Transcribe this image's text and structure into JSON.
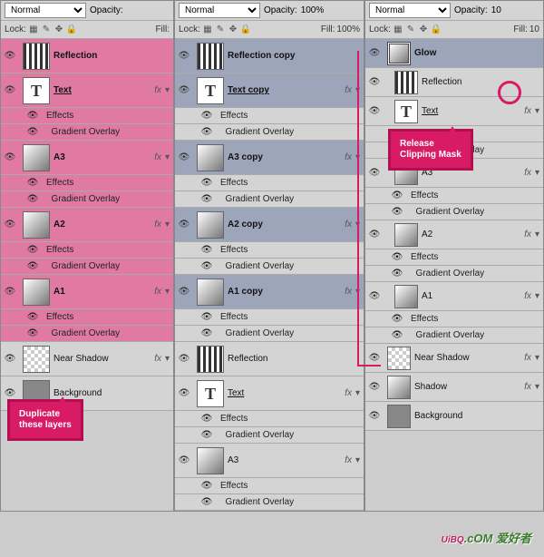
{
  "blend": "Normal",
  "opacityLabel": "Opacity:",
  "opacityVal": "100%",
  "lockLabel": "Lock:",
  "fillLabel": "Fill:",
  "fillVal": "100%",
  "effects": "Effects",
  "gradov": "Gradient Overlay",
  "fx": "fx",
  "panel1": {
    "layers": [
      {
        "name": "Reflection",
        "thumb": "bars",
        "sel": true,
        "pink": true,
        "bold": true
      },
      {
        "name": "Text",
        "thumb": "T",
        "sel": true,
        "pink": true,
        "bold": true,
        "u": true,
        "fx": true,
        "subs": true
      },
      {
        "name": "A3",
        "thumb": "grad",
        "sel": true,
        "pink": true,
        "bold": true,
        "fx": true,
        "subs": true
      },
      {
        "name": "A2",
        "thumb": "grad",
        "sel": true,
        "pink": true,
        "bold": true,
        "fx": true,
        "subs": true
      },
      {
        "name": "A1",
        "thumb": "grad",
        "sel": true,
        "pink": true,
        "bold": true,
        "fx": true,
        "subs": true
      },
      {
        "name": "Near Shadow",
        "thumb": "check",
        "fx": true
      },
      {
        "name": "Background",
        "thumb": "gray",
        "italic": true
      }
    ]
  },
  "panel2": {
    "layers": [
      {
        "name": "Reflection copy",
        "thumb": "bars",
        "sel": true,
        "bold": true
      },
      {
        "name": "Text copy",
        "thumb": "T",
        "sel": true,
        "bold": true,
        "u": true,
        "fx": true,
        "subs": true
      },
      {
        "name": "A3 copy",
        "thumb": "grad",
        "sel": true,
        "bold": true,
        "fx": true,
        "subs": true
      },
      {
        "name": "A2 copy",
        "thumb": "grad",
        "sel": true,
        "bold": true,
        "fx": true,
        "subs": true
      },
      {
        "name": "A1 copy",
        "thumb": "grad",
        "sel": true,
        "bold": true,
        "fx": true,
        "subs": true
      },
      {
        "name": "Reflection",
        "thumb": "bars"
      },
      {
        "name": "Text",
        "thumb": "T",
        "u": true,
        "fx": true,
        "subs": true
      },
      {
        "name": "A3",
        "thumb": "grad",
        "fx": true,
        "subs": true
      }
    ]
  },
  "panel3": {
    "layers": [
      {
        "name": "Glow",
        "thumb": "grad",
        "sel": true,
        "bold": true,
        "dbl": true
      },
      {
        "name": "Reflection",
        "thumb": "bars",
        "clip": true
      },
      {
        "name": "Text",
        "thumb": "T",
        "u": true,
        "fx": true,
        "subs": true,
        "clip": true
      },
      {
        "name": "A3",
        "thumb": "grad",
        "fx": true,
        "subs": true,
        "clip": true
      },
      {
        "name": "A2",
        "thumb": "grad",
        "fx": true,
        "subs": true,
        "clip": true
      },
      {
        "name": "A1",
        "thumb": "grad",
        "fx": true,
        "subs": true,
        "clip": true
      },
      {
        "name": "Near Shadow",
        "thumb": "check",
        "fx": true
      },
      {
        "name": "Shadow",
        "thumb": "grad",
        "fx": true
      },
      {
        "name": "Background",
        "thumb": "gray",
        "italic": true
      }
    ]
  },
  "callout1a": "Duplicate",
  "callout1b": "these layers",
  "callout2a": "Release",
  "callout2b": "Clipping Mask",
  "watermark": "UiBQ.cOM 爱好者",
  "opacityCut": "10"
}
